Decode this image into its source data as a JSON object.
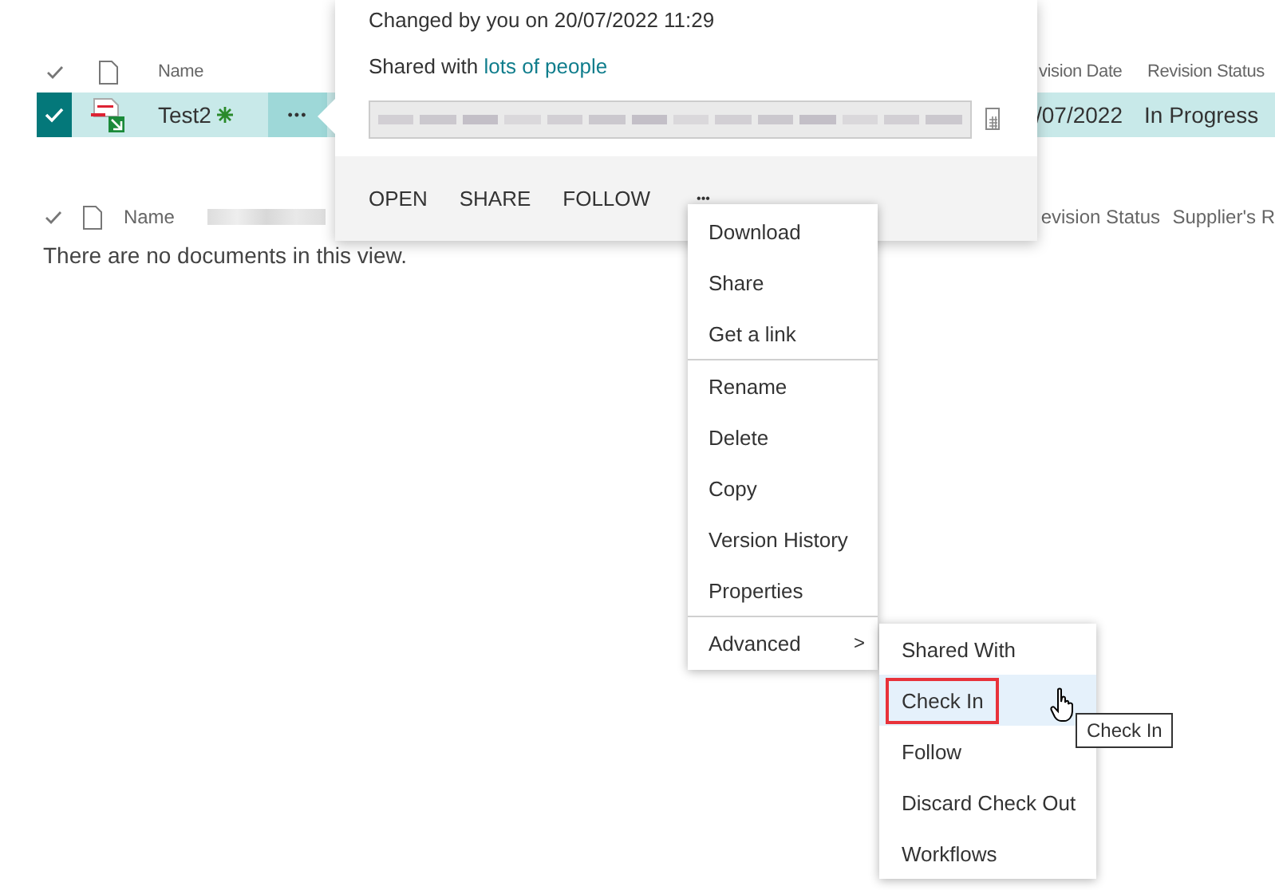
{
  "list": {
    "columns": [
      "Name",
      "vision Date",
      "Revision Status"
    ],
    "rows": [
      {
        "name": "Test2",
        "is_new": true,
        "more": "•••",
        "selected": true,
        "revision_date": "/07/2022",
        "revision_status": "In Progress"
      }
    ]
  },
  "callout": {
    "changed": "Changed by you on 20/07/2022 11:29",
    "shared_prefix": "Shared with",
    "shared_link": "lots of people",
    "actions": [
      "OPEN",
      "SHARE",
      "FOLLOW"
    ],
    "more": "•••"
  },
  "second_list": {
    "columns": [
      "Name",
      "evision Status",
      "Supplier's R"
    ],
    "empty_message": "There are no documents in this view."
  },
  "menu": {
    "groups": [
      [
        {
          "label": "Download"
        },
        {
          "label": "Share"
        },
        {
          "label": "Get a link"
        }
      ],
      [
        {
          "label": "Rename"
        },
        {
          "label": "Delete"
        },
        {
          "label": "Copy"
        },
        {
          "label": "Version History"
        },
        {
          "label": "Properties"
        }
      ],
      [
        {
          "label": "Advanced",
          "submenu_arrow": ">"
        }
      ]
    ]
  },
  "submenu": {
    "items": [
      {
        "label": "Shared With",
        "selected": false,
        "outlined": false
      },
      {
        "label": "Check In",
        "selected": true,
        "outlined": true
      },
      {
        "label": "Follow",
        "selected": false,
        "outlined": false
      },
      {
        "label": "Discard Check Out",
        "selected": false,
        "outlined": false
      },
      {
        "label": "Workflows",
        "selected": false,
        "outlined": false
      }
    ]
  },
  "tooltip": "Check In"
}
